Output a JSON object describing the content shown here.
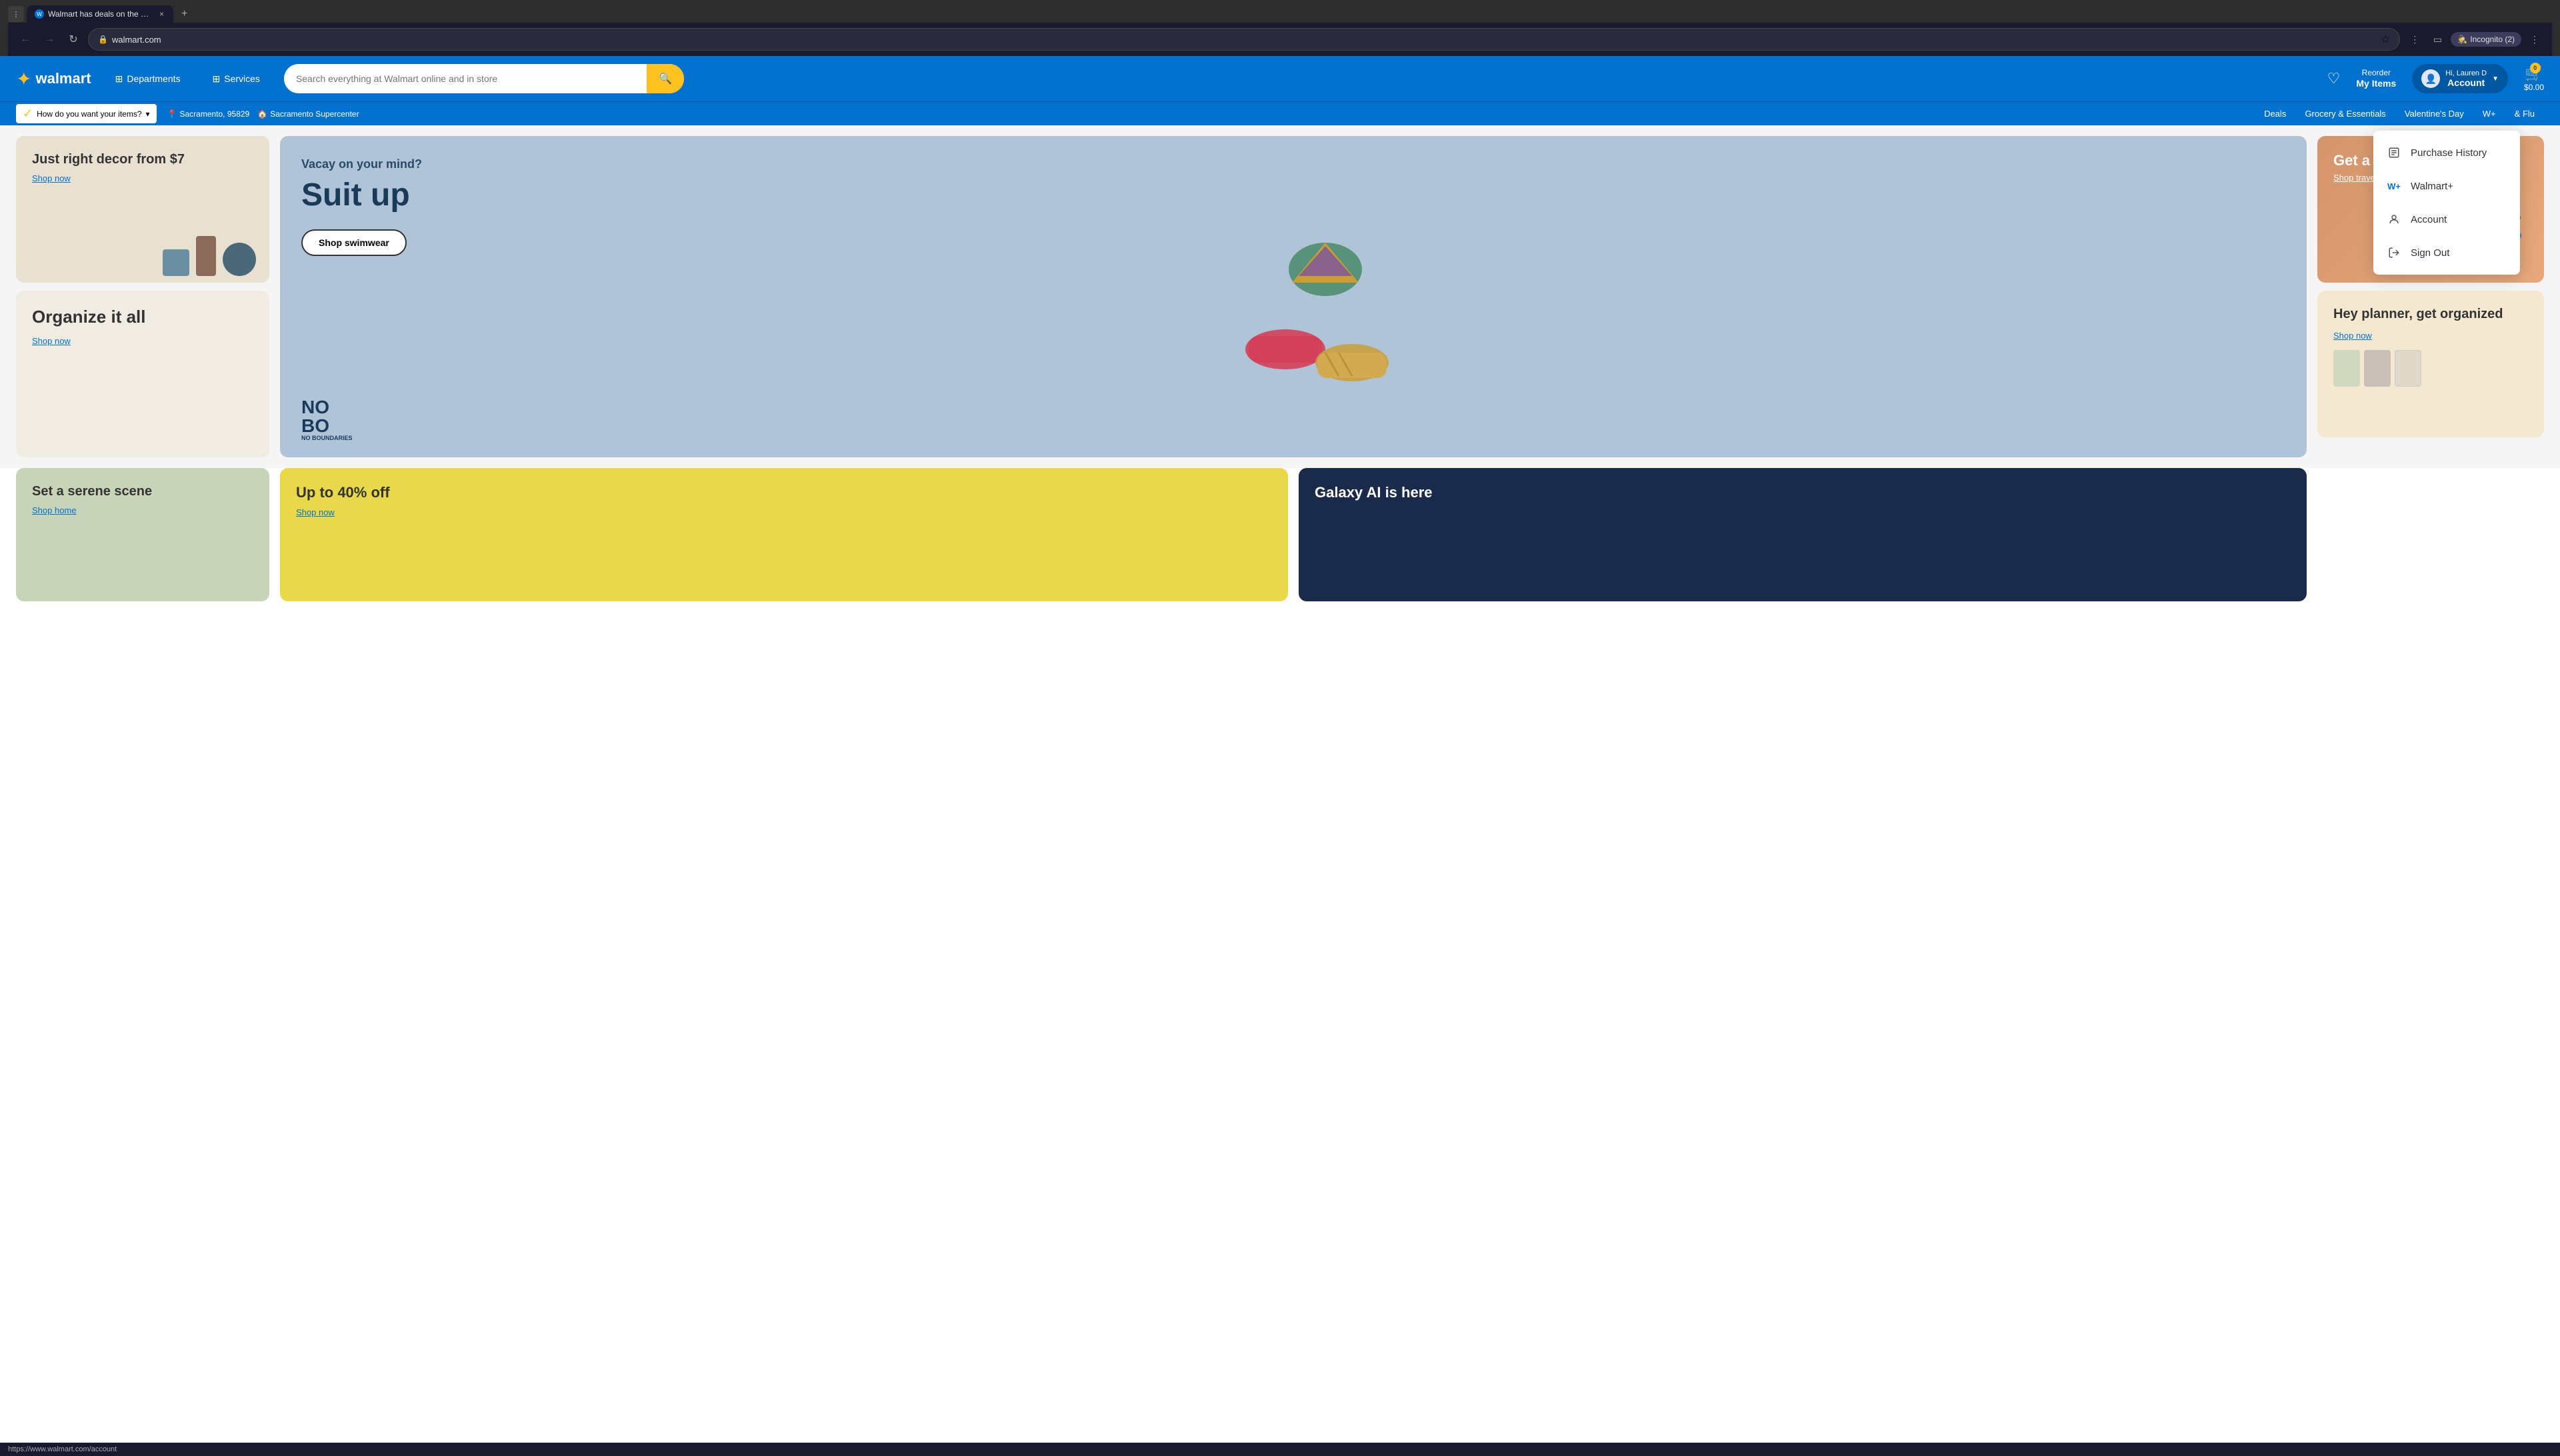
{
  "browser": {
    "tab_favicon": "W",
    "tab_title": "Walmart has deals on the most...",
    "tab_close": "×",
    "tab_new": "+",
    "back_btn": "←",
    "forward_btn": "→",
    "refresh_btn": "↻",
    "address": "walmart.com",
    "address_icon": "🔒",
    "bookmark_icon": "☆",
    "extensions_icon": "⋮",
    "sidebar_icon": "▭",
    "incognito_label": "Incognito (2)",
    "more_icon": "⋮",
    "status_url": "https://www.walmart.com/account"
  },
  "header": {
    "logo_text": "walmart",
    "spark": "✦",
    "departments_label": "Departments",
    "services_label": "Services",
    "search_placeholder": "Search everything at Walmart online and in store",
    "search_icon": "🔍",
    "reorder_line1": "Reorder",
    "reorder_line2": "My Items",
    "account_greeting": "Hi, Lauren D",
    "account_label": "Account",
    "cart_badge": "0",
    "cart_price": "$0.00"
  },
  "subnav": {
    "delivery_icon": "○",
    "delivery_label": "How do you want your items?",
    "delivery_chevron": "▾",
    "location_pin": "📍",
    "location": "Sacramento, 95829",
    "store_icon": "🏠",
    "store": "Sacramento Supercenter",
    "links": [
      "Deals",
      "Grocery & Essentials",
      "Valentine's Day",
      "W+",
      "& Flu"
    ]
  },
  "cards": {
    "decor_title": "Just right decor from $7",
    "decor_link": "Shop now",
    "organize_title": "Organize it all",
    "organize_link": "Shop now",
    "hero_subtitle": "Vacay on your mind?",
    "hero_title": "Suit up",
    "hero_btn": "Shop swimwear",
    "nobo_line1": "NO",
    "nobo_line2": "BO",
    "nobo_sub": "NO BOUNDARIES",
    "travel_title": "Get a style",
    "travel_p": "Shop travel",
    "organized2_title": "Hey planner, get organized",
    "organized2_link": "Shop now",
    "scene_title": "Set a serene scene",
    "scene_link": "Shop home",
    "off_title": "Up to 40% off",
    "off_link": "Shop now",
    "galaxy_title": "Galaxy AI is here"
  },
  "dropdown": {
    "purchase_history_icon": "□",
    "purchase_history_label": "Purchase History",
    "walmart_plus_icon": "W+",
    "walmart_plus_label": "Walmart+",
    "account_icon": "👤",
    "account_label": "Account",
    "signout_icon": "→",
    "signout_label": "Sign Out"
  }
}
